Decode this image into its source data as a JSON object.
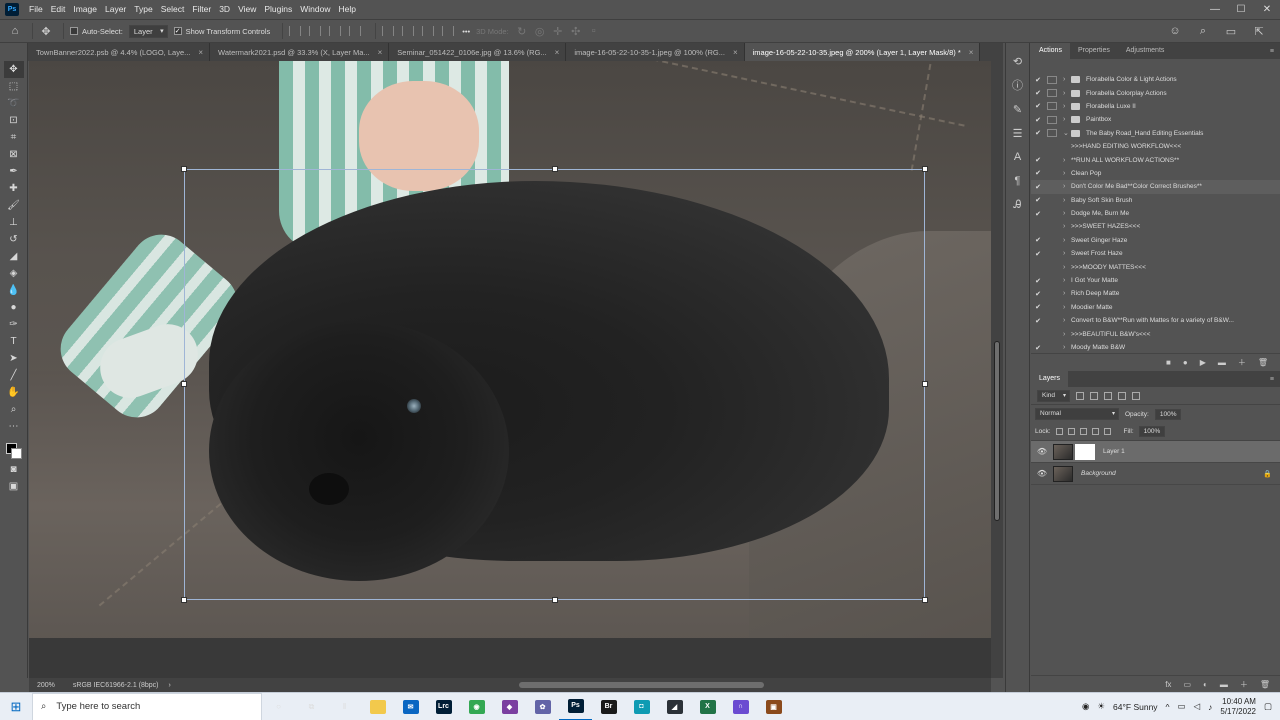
{
  "app": {
    "logo": "Ps"
  },
  "menu": [
    "File",
    "Edit",
    "Image",
    "Layer",
    "Type",
    "Select",
    "Filter",
    "3D",
    "View",
    "Plugins",
    "Window",
    "Help"
  ],
  "window_controls": {
    "minimize": "—",
    "maximize": "☐",
    "close": "✕"
  },
  "options_bar": {
    "auto_select_label": "Auto-Select:",
    "auto_select_value": "Layer",
    "show_transform_label": "Show Transform Controls",
    "three_d_mode_label": "3D Mode:",
    "more_label": "•••"
  },
  "tabs": [
    {
      "label": "TownBanner2022.psb @ 4.4% (LOGO, Laye...",
      "close": "×"
    },
    {
      "label": "Watermark2021.psd @ 33.3% (X, Layer Ma...",
      "close": "×"
    },
    {
      "label": "Seminar_051422_0106e.jpg @ 13.6% (RG...",
      "close": "×"
    },
    {
      "label": "image-16-05-22-10-35-1.jpeg @ 100% (RG...",
      "close": "×"
    },
    {
      "label": "image-16-05-22-10-35.jpeg @ 200% (Layer 1, Layer Mask/8) *",
      "close": "×"
    }
  ],
  "status": {
    "zoom": "200%",
    "profile": "sRGB IEC61966-2.1 (8bpc)",
    "arrow": "›"
  },
  "panels": {
    "top_tabs": [
      "Actions",
      "Properties",
      "Adjustments"
    ],
    "layers_tab": "Layers",
    "menu_icon": "≡"
  },
  "actions": [
    {
      "check": "✔",
      "dialog": true,
      "twisty": "›",
      "folder": true,
      "label": "Florabella Color & Light Actions"
    },
    {
      "check": "✔",
      "dialog": true,
      "twisty": "›",
      "folder": true,
      "label": "Florabella Colorplay Actions"
    },
    {
      "check": "✔",
      "dialog": true,
      "twisty": "›",
      "folder": true,
      "label": "Florabella Luxe II"
    },
    {
      "check": "✔",
      "dialog": true,
      "twisty": "›",
      "folder": true,
      "label": "Paintbox"
    },
    {
      "check": "✔",
      "dialog": true,
      "twisty": "⌄",
      "folder": true,
      "label": "The Baby Road_Hand Editing Essentials"
    },
    {
      "check": "",
      "dialog": false,
      "twisty": "",
      "folder": false,
      "label": ">>>HAND EDITING WORKFLOW<<<"
    },
    {
      "check": "✔",
      "dialog": false,
      "twisty": "›",
      "folder": false,
      "label": "**RUN ALL WORKFLOW ACTIONS**"
    },
    {
      "check": "✔",
      "dialog": false,
      "twisty": "›",
      "folder": false,
      "label": "Clean Pop"
    },
    {
      "check": "✔",
      "dialog": false,
      "twisty": "›",
      "folder": false,
      "label": "Don't Color Me Bad**Color Correct Brushes**",
      "highlight": true
    },
    {
      "check": "✔",
      "dialog": false,
      "twisty": "›",
      "folder": false,
      "label": "Baby Soft Skin Brush"
    },
    {
      "check": "✔",
      "dialog": false,
      "twisty": "›",
      "folder": false,
      "label": "Dodge Me, Burn Me"
    },
    {
      "check": "",
      "dialog": false,
      "twisty": "›",
      "folder": false,
      "label": ">>>SWEET HAZES<<<"
    },
    {
      "check": "✔",
      "dialog": false,
      "twisty": "›",
      "folder": false,
      "label": "Sweet Ginger Haze"
    },
    {
      "check": "✔",
      "dialog": false,
      "twisty": "›",
      "folder": false,
      "label": "Sweet Frost Haze"
    },
    {
      "check": "",
      "dialog": false,
      "twisty": "›",
      "folder": false,
      "label": ">>>MOODY MATTES<<<"
    },
    {
      "check": "✔",
      "dialog": false,
      "twisty": "›",
      "folder": false,
      "label": "I Got Your Matte"
    },
    {
      "check": "✔",
      "dialog": false,
      "twisty": "›",
      "folder": false,
      "label": "Rich Deep Matte"
    },
    {
      "check": "✔",
      "dialog": false,
      "twisty": "›",
      "folder": false,
      "label": "Moodier Matte"
    },
    {
      "check": "✔",
      "dialog": false,
      "twisty": "›",
      "folder": false,
      "label": "Convert to B&W**Run with Mattes for a variety of B&W..."
    },
    {
      "check": "",
      "dialog": false,
      "twisty": "›",
      "folder": false,
      "label": ">>>BEAUTIFUL B&W's<<<"
    },
    {
      "check": "✔",
      "dialog": false,
      "twisty": "›",
      "folder": false,
      "label": "Moody Matte B&W"
    }
  ],
  "actions_footer": [
    "■",
    "●",
    "▶",
    "▬",
    "＋",
    "🗑"
  ],
  "layers": {
    "filter_kind": "Kind",
    "blend_mode": "Normal",
    "opacity_label": "Opacity:",
    "opacity_value": "100%",
    "lock_label": "Lock:",
    "fill_label": "Fill:",
    "fill_value": "100%",
    "items": [
      {
        "name": "Layer 1",
        "eye": "👁",
        "selected": true
      },
      {
        "name": "Background",
        "eye": "👁",
        "lock": "🔒"
      }
    ],
    "footer": [
      "fx",
      "▭",
      "◐",
      "▬",
      "＋",
      "🗑"
    ]
  },
  "taskbar": {
    "search_placeholder": "Type here to search",
    "weather": "64°F  Sunny",
    "time": "10:40 AM",
    "date": "5/17/2022",
    "apps": [
      {
        "name": "explorer",
        "color": "#f2c94c",
        "glyph": ""
      },
      {
        "name": "mail",
        "color": "#0a66c2",
        "glyph": "✉"
      },
      {
        "name": "lightroom",
        "color": "#001e36",
        "glyph": "Lrc"
      },
      {
        "name": "chrome",
        "color": "#34a853",
        "glyph": "◉"
      },
      {
        "name": "app-colorful",
        "color": "#7b3fa0",
        "glyph": "◆"
      },
      {
        "name": "settings",
        "color": "#6264a7",
        "glyph": "✿"
      },
      {
        "name": "photoshop",
        "color": "#001e36",
        "glyph": "Ps"
      },
      {
        "name": "bridge",
        "color": "#1a1a1a",
        "glyph": "Br"
      },
      {
        "name": "app-teal",
        "color": "#0f9bb3",
        "glyph": "◘"
      },
      {
        "name": "app-dark",
        "color": "#2b3137",
        "glyph": "◢"
      },
      {
        "name": "excel",
        "color": "#217346",
        "glyph": "X"
      },
      {
        "name": "headset",
        "color": "#6b4bd1",
        "glyph": "∩"
      },
      {
        "name": "app-brown",
        "color": "#8b4a1c",
        "glyph": "▣"
      }
    ]
  }
}
